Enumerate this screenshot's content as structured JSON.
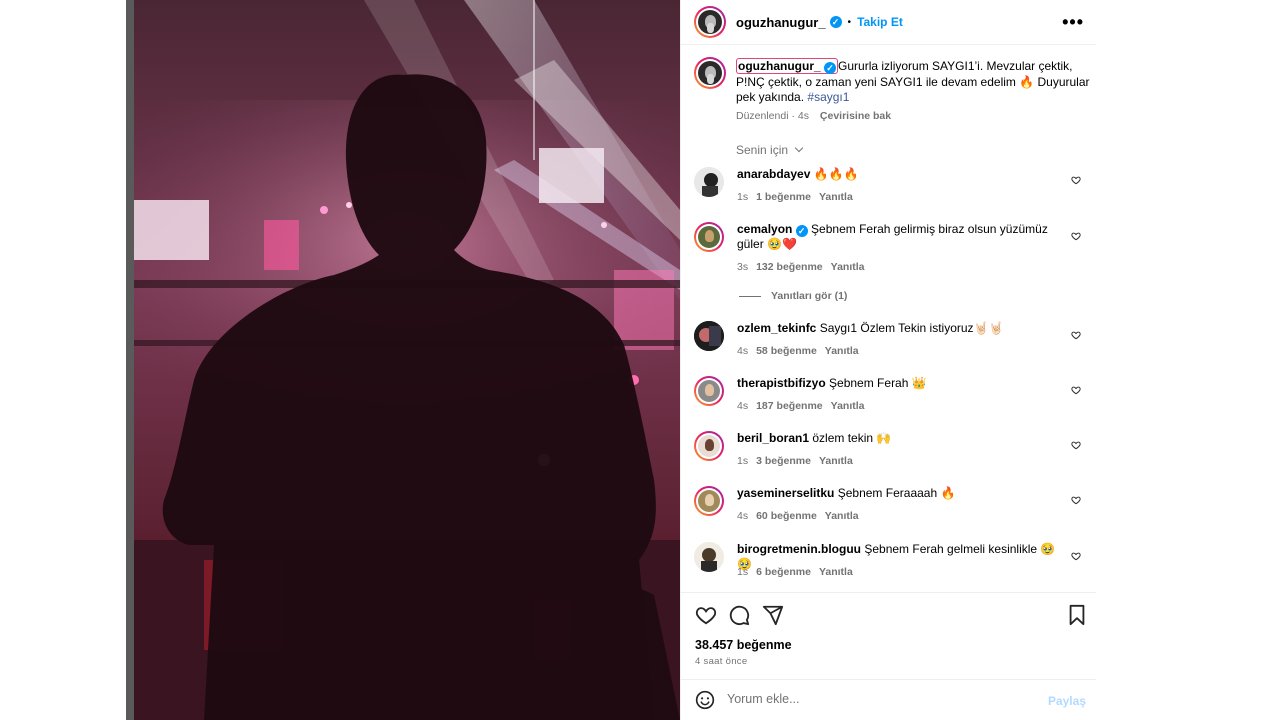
{
  "post": {
    "image_description_icon": "concert-silhouette-photo",
    "header": {
      "username": "oguzhanugur_",
      "separator": "•",
      "follow_label": "Takip Et",
      "more_label": "•••"
    },
    "caption": {
      "username": "oguzhanugur_",
      "text": "Gururla izliyorum SAYGI1’i. Mevzular çektik, P!NÇ çektik, o zaman yeni SAYGI1 ile devam edelim 🔥 Duyurular pek yakında.",
      "hashtag": "#saygı1",
      "edited_label": "Düzenlendi",
      "time": "4s",
      "translate_label": "Çevirisine bak"
    },
    "for_you_label": "Senin için",
    "comments": [
      {
        "username": "anarabdayev",
        "text": "🔥🔥🔥",
        "time": "1s",
        "likes": "1 beğenme",
        "reply": "Yanıtla",
        "verified": false
      },
      {
        "username": "cemalyon",
        "text": "Şebnem Ferah gelirmiş biraz olsun yüzümüz güler 🥹❤️",
        "time": "3s",
        "likes": "132 beğenme",
        "reply": "Yanıtla",
        "verified": true
      },
      {
        "username": "ozlem_tekinfc",
        "text": "Saygı1 Özlem Tekin istiyoruz🤘🏻🤘🏻",
        "time": "4s",
        "likes": "58 beğenme",
        "reply": "Yanıtla",
        "verified": false
      },
      {
        "username": "therapistbifizyo",
        "text": "Şebnem Ferah 👑",
        "time": "4s",
        "likes": "187 beğenme",
        "reply": "Yanıtla",
        "verified": false
      },
      {
        "username": "beril_boran1",
        "text": "özlem tekin 🙌",
        "time": "1s",
        "likes": "3 beğenme",
        "reply": "Yanıtla",
        "verified": false
      },
      {
        "username": "yaseminerselitku",
        "text": "Şebnem Feraaaah 🔥",
        "time": "4s",
        "likes": "60 beğenme",
        "reply": "Yanıtla",
        "verified": false
      },
      {
        "username": "birogretmenin.bloguu",
        "text": "Şebnem Ferah gelmeli kesinlikle 🥹🥹",
        "time": "1s",
        "likes": "6 beğenme",
        "reply": "Yanıtla",
        "verified": false
      }
    ],
    "view_replies_label": "Yanıtları gör (1)",
    "like_count": "38.457 beğenme",
    "posted_time": "4 saat önce",
    "comment_placeholder": "Yorum ekle...",
    "post_label": "Paylaş"
  },
  "colors": {
    "accent_blue": "#0095f6",
    "muted_text": "#737373",
    "post_disabled": "#b3dbff",
    "story_ring": "#e91e63"
  }
}
